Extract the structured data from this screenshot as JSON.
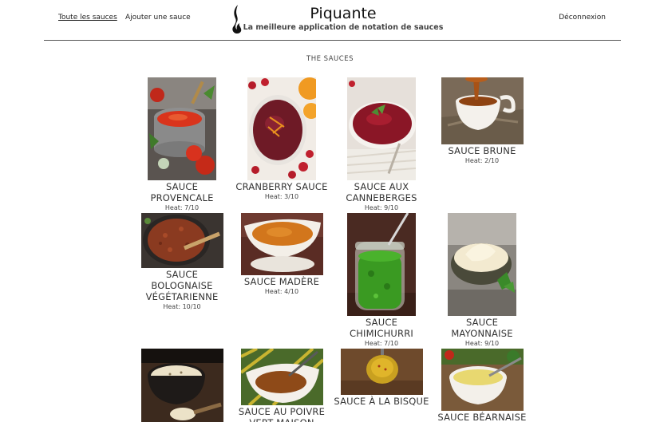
{
  "nav": {
    "all_sauces": "Toute les sauces",
    "add_sauce": "Ajouter une sauce",
    "logout": "Déconnexion"
  },
  "brand": {
    "title": "Piquante",
    "subtitle": "La meilleure application de notation de sauces"
  },
  "section_title": "THE SAUCES",
  "heat_label": "Heat:",
  "sauces": [
    {
      "name": "Sauce Provencale",
      "heat": "7/10",
      "image": "tomato-pot"
    },
    {
      "name": "Cranberry Sauce",
      "heat": "3/10",
      "image": "cranberry-bowl"
    },
    {
      "name": "Sauce aux Canneberges",
      "heat": "9/10",
      "image": "cranberry-dish"
    },
    {
      "name": "Sauce Brune",
      "heat": "2/10",
      "image": "gravy-boat"
    },
    {
      "name": "Sauce Bolognaise Végétarienne",
      "heat": "10/10",
      "image": "bolognese-pan"
    },
    {
      "name": "Sauce Madère",
      "heat": "4/10",
      "image": "madeira-boat"
    },
    {
      "name": "Sauce Chimichurri",
      "heat": "7/10",
      "image": "chimichurri-jar"
    },
    {
      "name": "Sauce Mayonnaise",
      "heat": "9/10",
      "image": "mayonnaise-bowl"
    },
    {
      "name": "",
      "heat": "",
      "image": "cream-bowl"
    },
    {
      "name": "Sauce au Poivre Vert Maison",
      "heat": "",
      "image": "pepper-gravy"
    },
    {
      "name": "Sauce à la Bisque",
      "heat": "",
      "image": "bisque-spoon"
    },
    {
      "name": "Sauce Béarnaise",
      "heat": "",
      "image": "bearnaise-bowl"
    }
  ]
}
